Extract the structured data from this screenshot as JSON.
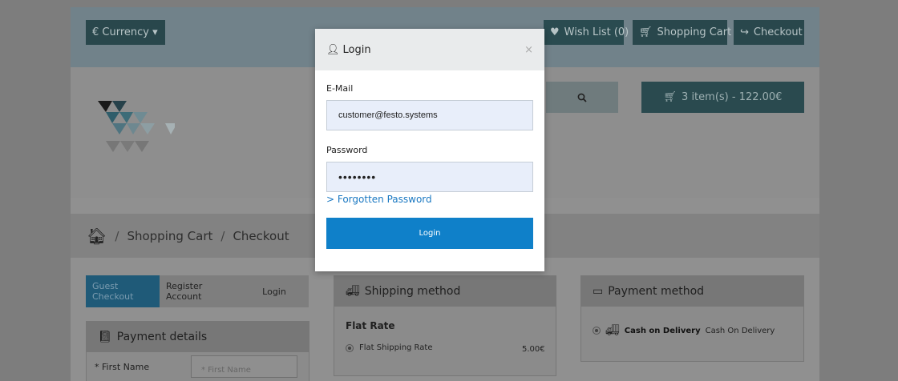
{
  "topbar": {
    "currency_label": "€ Currency ▾",
    "wishlist_label": "Wish List (0)",
    "cart_label": "Shopping Cart",
    "checkout_label": "Checkout"
  },
  "header": {
    "cart_summary": "3 item(s) - 122.00€"
  },
  "breadcrumb": {
    "items": [
      "Shopping Cart",
      "Checkout"
    ],
    "separator": "/"
  },
  "checkout_tabs": [
    "Guest Checkout",
    "Register Account",
    "Login"
  ],
  "panels": {
    "payment_details": {
      "title": "Payment details",
      "first_name_label": "* First Name",
      "first_name_placeholder": "* First Name"
    },
    "shipping": {
      "title": "Shipping method",
      "rate_title": "Flat Rate",
      "option_label": "Flat Shipping Rate",
      "option_price": "5.00€"
    },
    "payment_method": {
      "title": "Payment method",
      "logo_text": "Cash on Delivery",
      "option_label": "Cash On Delivery"
    }
  },
  "modal": {
    "title": "Login",
    "email_label": "E-Mail",
    "email_value": "customer@festo.systems",
    "password_label": "Password",
    "password_value": "••••••••",
    "forgot_label": "> Forgotten Password",
    "login_button": "Login"
  },
  "colors": {
    "overlay_bg": "#7d7d7d",
    "accent": "#0f80c9",
    "dark_button": "#29474c"
  }
}
